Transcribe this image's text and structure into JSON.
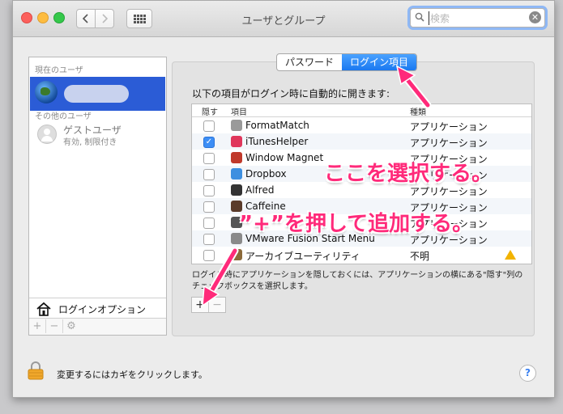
{
  "window": {
    "title": "ユーザとグループ"
  },
  "search": {
    "placeholder": "検索"
  },
  "sidebar": {
    "current_header": "現在のユーザ",
    "other_header": "その他のユーザ",
    "guest_name": "ゲストユーザ",
    "guest_status": "有効, 制限付き",
    "login_options": "ログインオプション",
    "add": "+",
    "remove": "−"
  },
  "tabs": [
    {
      "label": "パスワード",
      "active": false
    },
    {
      "label": "ログイン項目",
      "active": true
    }
  ],
  "login_items": {
    "description": "以下の項目がログイン時に自動的に開きます:",
    "headers": {
      "hide": "隠す",
      "item": "項目",
      "kind": "種類"
    },
    "rows": [
      {
        "name": "FormatMatch",
        "kind": "アプリケーション",
        "hidden": false,
        "icon": "formatmatch-icon",
        "color": "#9a9a9a"
      },
      {
        "name": "iTunesHelper",
        "kind": "アプリケーション",
        "hidden": true,
        "icon": "itunes-icon",
        "color": "#e0365b"
      },
      {
        "name": "Window Magnet",
        "kind": "アプリケーション",
        "hidden": false,
        "icon": "magnet-icon",
        "color": "#c0392b"
      },
      {
        "name": "Dropbox",
        "kind": "アプリケーション",
        "hidden": false,
        "icon": "dropbox-icon",
        "color": "#3d8fe0"
      },
      {
        "name": "Alfred",
        "kind": "アプリケーション",
        "hidden": false,
        "icon": "alfred-icon",
        "color": "#333333"
      },
      {
        "name": "Caffeine",
        "kind": "アプリケーション",
        "hidden": false,
        "icon": "caffeine-icon",
        "color": "#5a3b2a"
      },
      {
        "name": "",
        "kind": "アプリケーション",
        "hidden": false,
        "icon": "app-icon",
        "color": "#555555"
      },
      {
        "name": "VMware Fusion Start Menu",
        "kind": "アプリケーション",
        "hidden": false,
        "icon": "vmware-icon",
        "color": "#8a8a8a"
      },
      {
        "name": "アーカイブユーティリティ",
        "kind": "不明",
        "hidden": false,
        "icon": "archive-icon",
        "color": "#8c6a3a",
        "warning": true
      }
    ],
    "note": "ログイン時にアプリケーションを隠しておくには、アプリケーションの横にある\"隠す\"列のチェックボックスを選択します。",
    "add": "+",
    "remove": "−"
  },
  "footer": {
    "lock_text": "変更するにはカギをクリックします。",
    "help": "?"
  },
  "annotations": {
    "select_here": "ここを選択する。",
    "press_plus": "”+”を押して追加する。"
  },
  "colors": {
    "accent": "#1a78f0",
    "annotation": "#ff2a7a",
    "selection": "#2b5cd6"
  }
}
